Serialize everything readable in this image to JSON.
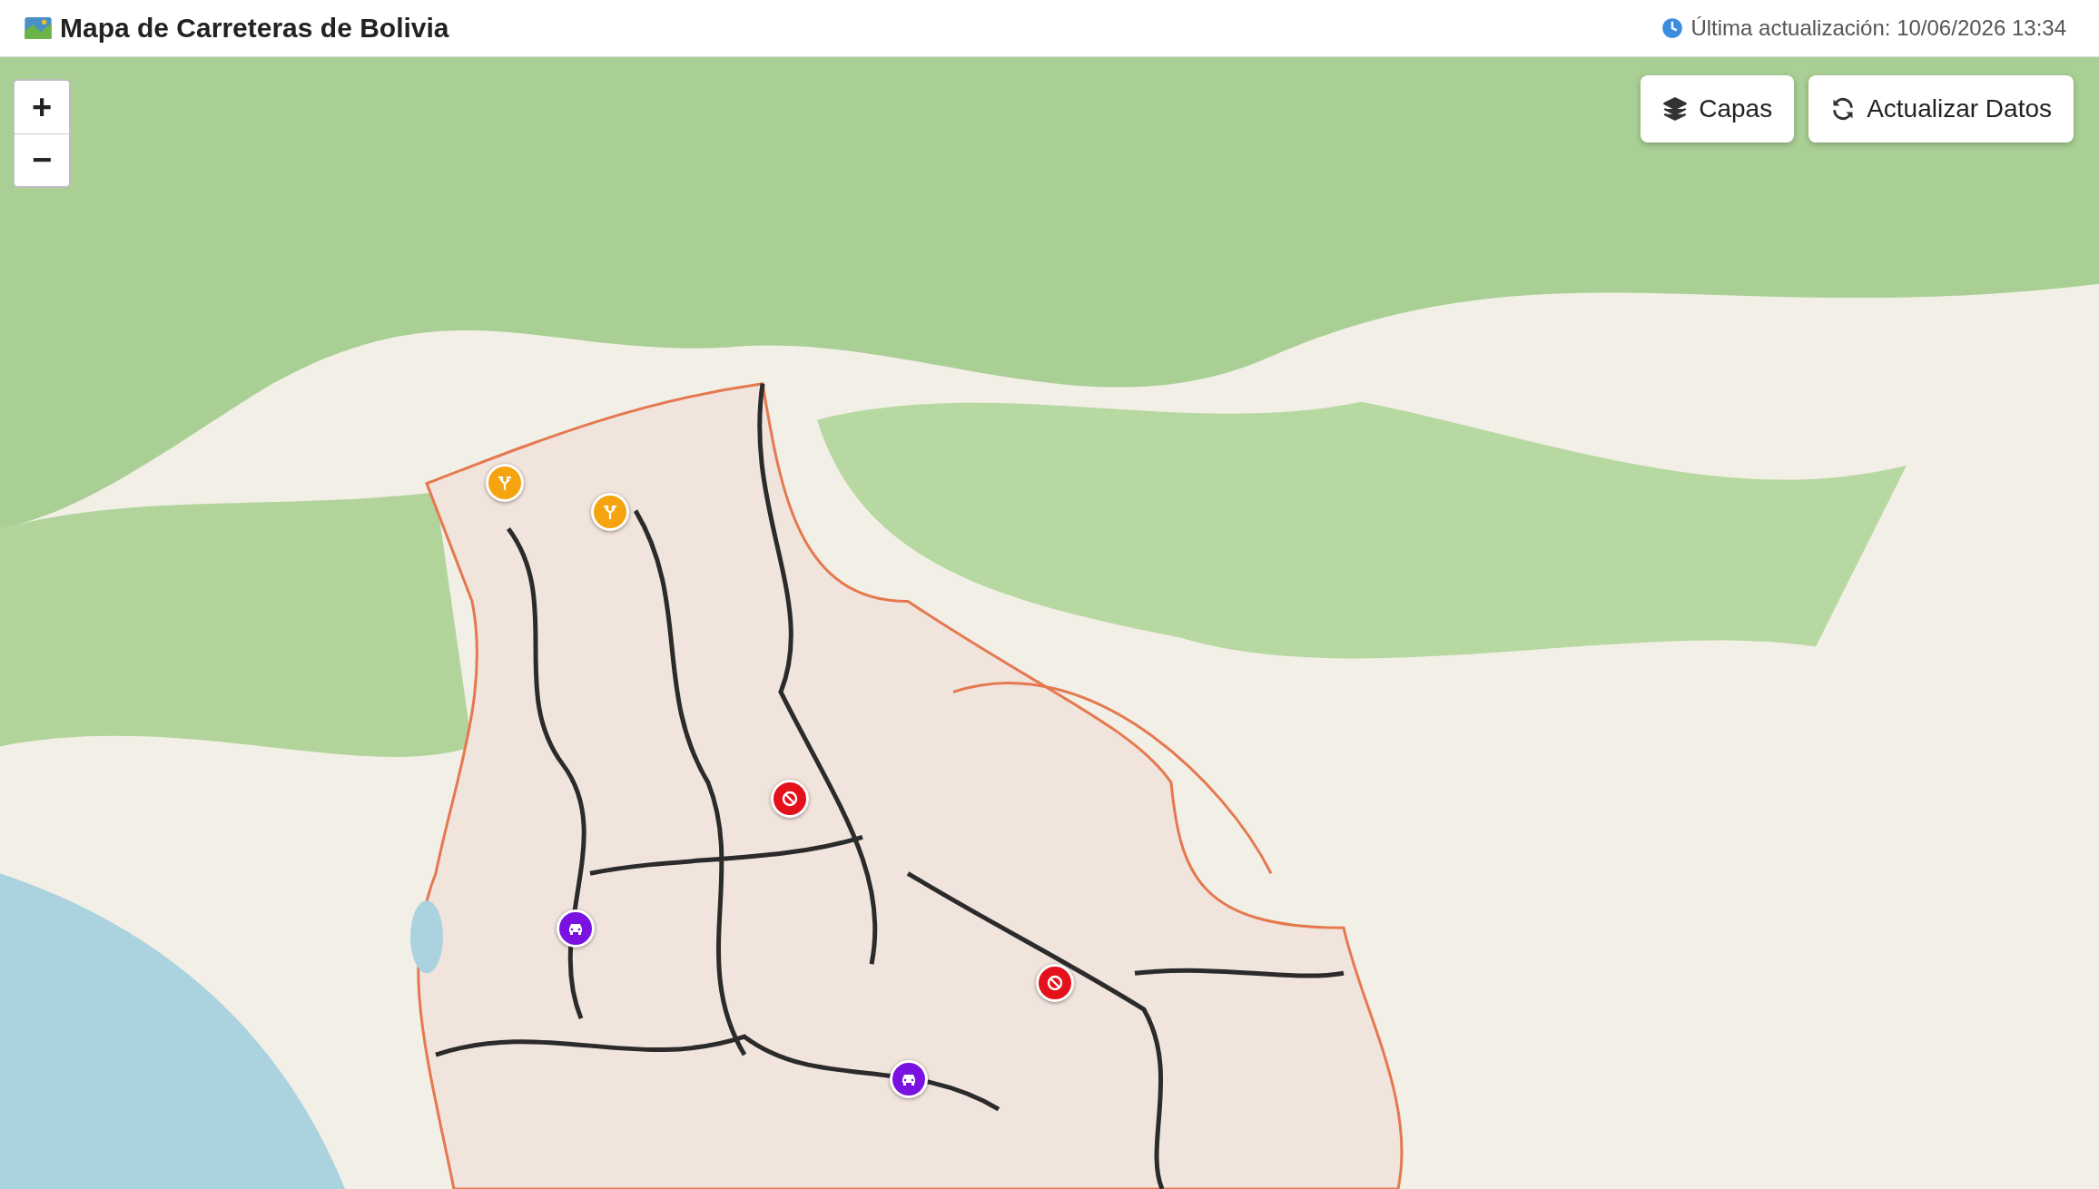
{
  "header": {
    "title": "Mapa de Carreteras de Bolivia",
    "last_update": "Última actualización: 10/06/2026 13:34"
  },
  "zoom_controls": [
    "+",
    "−"
  ],
  "map_buttons": [
    {
      "kind": "layers",
      "label": "Capas"
    },
    {
      "kind": "refresh",
      "label": "Actualizar Datos"
    }
  ],
  "markers": [
    {
      "kind": "detour",
      "color": "#f5a30f"
    },
    {
      "kind": "detour",
      "color": "#f5a30f"
    },
    {
      "kind": "closure",
      "color": "#e3111b"
    },
    {
      "kind": "closure",
      "color": "#e3111b"
    },
    {
      "kind": "traffic",
      "color": "#7a12e0"
    },
    {
      "kind": "traffic",
      "color": "#7a12e0"
    }
  ]
}
